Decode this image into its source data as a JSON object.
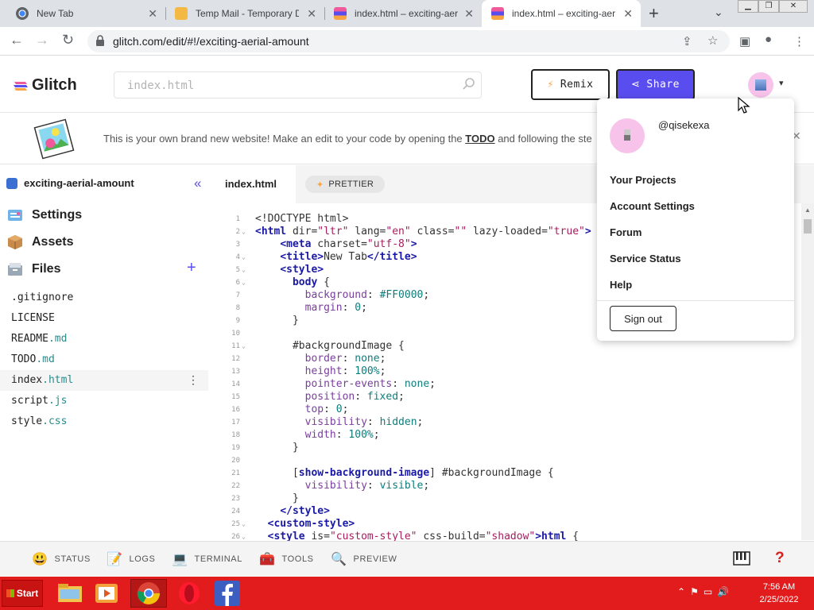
{
  "browser": {
    "tabs": [
      {
        "title": "New Tab",
        "active": false
      },
      {
        "title": "Temp Mail - Temporary Disp",
        "active": false
      },
      {
        "title": "index.html – exciting-aerial-",
        "active": false
      },
      {
        "title": "index.html – exciting-aerial-",
        "active": true
      }
    ],
    "new_tab": "+",
    "url": "glitch.com/edit/#!/exciting-aerial-amount"
  },
  "header": {
    "logo": "Glitch",
    "search_placeholder": "index.html",
    "remix_label": "Remix",
    "share_label": "Share"
  },
  "banner": {
    "text_before": "This is your own brand new website! Make an edit to your code by opening the ",
    "link": "TODO",
    "text_after": " and following the ste"
  },
  "sidebar": {
    "project": "exciting-aerial-amount",
    "sections": [
      {
        "label": "Settings",
        "icon": "settings-icon"
      },
      {
        "label": "Assets",
        "icon": "assets-icon"
      },
      {
        "label": "Files",
        "icon": "files-icon"
      }
    ],
    "files": [
      {
        "base": ".gitignore",
        "ext": ""
      },
      {
        "base": "LICENSE",
        "ext": ""
      },
      {
        "base": "README",
        "ext": ".md"
      },
      {
        "base": "TODO",
        "ext": ".md"
      },
      {
        "base": "index",
        "ext": ".html",
        "selected": true
      },
      {
        "base": "script",
        "ext": ".js"
      },
      {
        "base": "style",
        "ext": ".css"
      }
    ]
  },
  "editor": {
    "tab": "index.html",
    "prettier": "PRETTIER",
    "line_numbers": [
      "1",
      "2",
      "3",
      "4",
      "5",
      "6",
      "7",
      "8",
      "9",
      "10",
      "11",
      "12",
      "13",
      "14",
      "15",
      "16",
      "17",
      "18",
      "19",
      "20",
      "21",
      "22",
      "23",
      "24",
      "25",
      "26"
    ],
    "fold_lines": [
      "2",
      "4",
      "5",
      "6",
      "11",
      "25",
      "26"
    ],
    "lines": [
      [
        {
          "c": "a",
          "t": "<!DOCTYPE html>"
        }
      ],
      [
        {
          "c": "t",
          "t": "<html "
        },
        {
          "c": "a",
          "t": "dir="
        },
        {
          "c": "s",
          "t": "\"ltr\""
        },
        {
          "c": "a",
          "t": " lang="
        },
        {
          "c": "s",
          "t": "\"en\""
        },
        {
          "c": "a",
          "t": " class="
        },
        {
          "c": "s",
          "t": "\"\""
        },
        {
          "c": "a",
          "t": " lazy-loaded="
        },
        {
          "c": "s",
          "t": "\"true\""
        },
        {
          "c": "t",
          "t": ">"
        }
      ],
      [
        {
          "c": "a",
          "t": "    "
        },
        {
          "c": "t",
          "t": "<meta "
        },
        {
          "c": "a",
          "t": "charset="
        },
        {
          "c": "s",
          "t": "\"utf-8\""
        },
        {
          "c": "t",
          "t": ">"
        }
      ],
      [
        {
          "c": "a",
          "t": "    "
        },
        {
          "c": "t",
          "t": "<title>"
        },
        {
          "c": "a",
          "t": "New Tab"
        },
        {
          "c": "t",
          "t": "</title>"
        }
      ],
      [
        {
          "c": "a",
          "t": "    "
        },
        {
          "c": "t",
          "t": "<style>"
        }
      ],
      [
        {
          "c": "a",
          "t": "      "
        },
        {
          "c": "t",
          "t": "body"
        },
        {
          "c": "a",
          "t": " {"
        }
      ],
      [
        {
          "c": "a",
          "t": "        "
        },
        {
          "c": "p",
          "t": "background"
        },
        {
          "c": "a",
          "t": ": "
        },
        {
          "c": "v",
          "t": "#FF0000"
        },
        {
          "c": "a",
          "t": ";"
        }
      ],
      [
        {
          "c": "a",
          "t": "        "
        },
        {
          "c": "p",
          "t": "margin"
        },
        {
          "c": "a",
          "t": ": "
        },
        {
          "c": "v",
          "t": "0"
        },
        {
          "c": "a",
          "t": ";"
        }
      ],
      [
        {
          "c": "a",
          "t": "      }"
        }
      ],
      [
        {
          "c": "a",
          "t": ""
        }
      ],
      [
        {
          "c": "a",
          "t": "      #backgroundImage {"
        }
      ],
      [
        {
          "c": "a",
          "t": "        "
        },
        {
          "c": "p",
          "t": "border"
        },
        {
          "c": "a",
          "t": ": "
        },
        {
          "c": "v",
          "t": "none"
        },
        {
          "c": "a",
          "t": ";"
        }
      ],
      [
        {
          "c": "a",
          "t": "        "
        },
        {
          "c": "p",
          "t": "height"
        },
        {
          "c": "a",
          "t": ": "
        },
        {
          "c": "v",
          "t": "100%"
        },
        {
          "c": "a",
          "t": ";"
        }
      ],
      [
        {
          "c": "a",
          "t": "        "
        },
        {
          "c": "p",
          "t": "pointer-events"
        },
        {
          "c": "a",
          "t": ": "
        },
        {
          "c": "v",
          "t": "none"
        },
        {
          "c": "a",
          "t": ";"
        }
      ],
      [
        {
          "c": "a",
          "t": "        "
        },
        {
          "c": "p",
          "t": "position"
        },
        {
          "c": "a",
          "t": ": "
        },
        {
          "c": "v",
          "t": "fixed"
        },
        {
          "c": "a",
          "t": ";"
        }
      ],
      [
        {
          "c": "a",
          "t": "        "
        },
        {
          "c": "p",
          "t": "top"
        },
        {
          "c": "a",
          "t": ": "
        },
        {
          "c": "v",
          "t": "0"
        },
        {
          "c": "a",
          "t": ";"
        }
      ],
      [
        {
          "c": "a",
          "t": "        "
        },
        {
          "c": "p",
          "t": "visibility"
        },
        {
          "c": "a",
          "t": ": "
        },
        {
          "c": "v",
          "t": "hidden"
        },
        {
          "c": "a",
          "t": ";"
        }
      ],
      [
        {
          "c": "a",
          "t": "        "
        },
        {
          "c": "p",
          "t": "width"
        },
        {
          "c": "a",
          "t": ": "
        },
        {
          "c": "v",
          "t": "100%"
        },
        {
          "c": "a",
          "t": ";"
        }
      ],
      [
        {
          "c": "a",
          "t": "      }"
        }
      ],
      [
        {
          "c": "a",
          "t": ""
        }
      ],
      [
        {
          "c": "a",
          "t": "      ["
        },
        {
          "c": "t",
          "t": "show-background-image"
        },
        {
          "c": "a",
          "t": "] #backgroundImage {"
        }
      ],
      [
        {
          "c": "a",
          "t": "        "
        },
        {
          "c": "p",
          "t": "visibility"
        },
        {
          "c": "a",
          "t": ": "
        },
        {
          "c": "v",
          "t": "visible"
        },
        {
          "c": "a",
          "t": ";"
        }
      ],
      [
        {
          "c": "a",
          "t": "      }"
        }
      ],
      [
        {
          "c": "a",
          "t": "    "
        },
        {
          "c": "t",
          "t": "</style>"
        }
      ],
      [
        {
          "c": "a",
          "t": "  "
        },
        {
          "c": "t",
          "t": "<custom-style>"
        }
      ],
      [
        {
          "c": "a",
          "t": "  "
        },
        {
          "c": "t",
          "t": "<style "
        },
        {
          "c": "a",
          "t": "is="
        },
        {
          "c": "s",
          "t": "\"custom-style\""
        },
        {
          "c": "a",
          "t": " css-build="
        },
        {
          "c": "s",
          "t": "\"shadow\""
        },
        {
          "c": "t",
          "t": ">html"
        },
        {
          "c": "a",
          "t": " {"
        }
      ]
    ]
  },
  "user_menu": {
    "username": "@qisekexa",
    "items": [
      "Your Projects",
      "Account Settings",
      "Forum",
      "Service Status",
      "Help"
    ],
    "sign_out": "Sign out"
  },
  "bottom_bar": {
    "items": [
      {
        "label": "STATUS",
        "icon": "status-icon",
        "glyph": "😃"
      },
      {
        "label": "LOGS",
        "icon": "logs-icon",
        "glyph": "📝"
      },
      {
        "label": "TERMINAL",
        "icon": "terminal-icon",
        "glyph": "💻"
      },
      {
        "label": "TOOLS",
        "icon": "tools-icon",
        "glyph": "🧰"
      },
      {
        "label": "PREVIEW",
        "icon": "preview-icon",
        "glyph": "🔍"
      }
    ],
    "help": "?"
  },
  "taskbar": {
    "start": "Start",
    "time": "7:56 AM",
    "date": "2/25/2022"
  },
  "colors": {
    "accent": "#5a4df0",
    "taskbar": "#e21c1c",
    "avatar": "#f7c3ea"
  }
}
